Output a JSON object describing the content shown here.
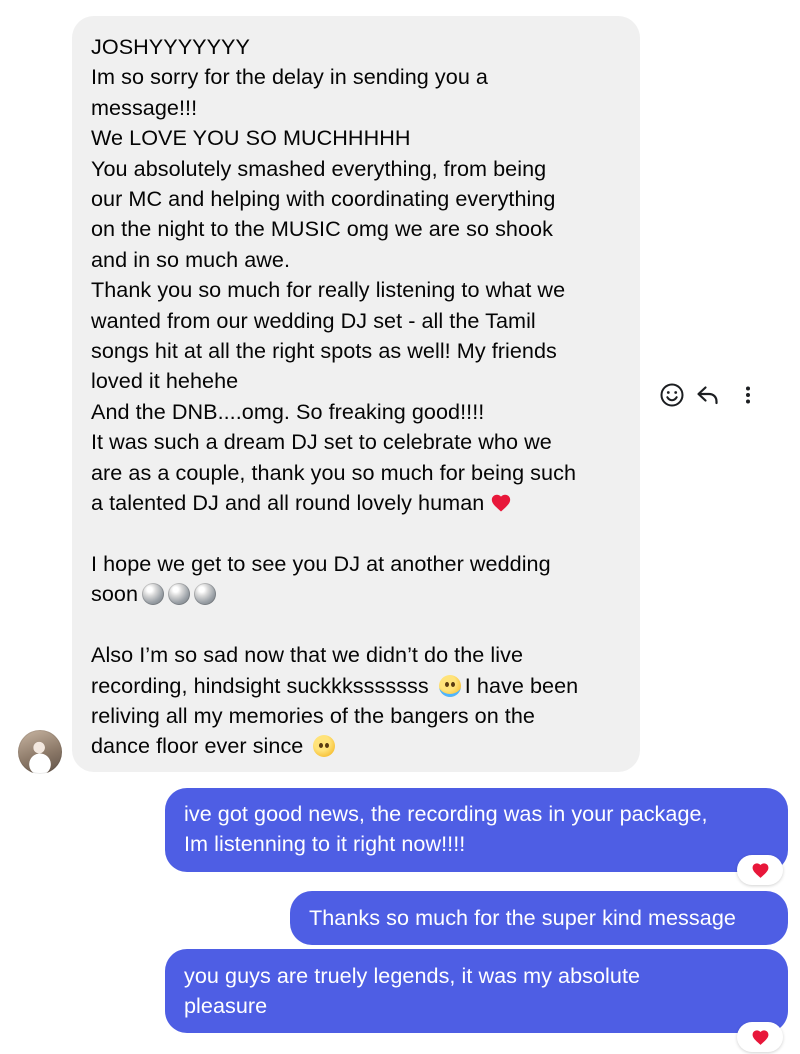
{
  "incoming_message": {
    "lines": [
      "JOSHYYYYYYY",
      "Im so sorry for the delay in sending you a",
      "message!!!",
      "We LOVE YOU SO MUCHHHHH",
      "You absolutely smashed everything, from being",
      "our MC and helping with coordinating everything",
      "on the night to the MUSIC omg we are so shook",
      "and in so much awe.",
      "Thank you so much for really listening to what we",
      "wanted from our wedding DJ set - all the Tamil",
      "songs hit at all the right spots as well! My friends",
      "loved it hehehe",
      "And the DNB....omg. So freaking good!!!!",
      "It was such a dream DJ set to celebrate who we",
      "are as a couple, thank you so much for being such",
      "a talented DJ and all round lovely human",
      "",
      "I hope we get to see you DJ at another wedding",
      "soon",
      "",
      "Also I’m so sad now that we didn’t do the live",
      "recording, hindsight suckkksssssss",
      "I have been",
      "reliving all my memories of the bangers on the",
      "dance floor ever since"
    ],
    "emojis": {
      "heart": "red-heart",
      "disco_ball": "mirror-ball",
      "crying_face": "loudly-crying-face",
      "pleading_face": "pleading-face"
    }
  },
  "actions": {
    "react_icon": "smile-icon",
    "reply_icon": "reply-icon",
    "more_icon": "more-vertical-icon"
  },
  "outgoing_messages": [
    {
      "lines": [
        "ive got good news, the recording was in your package,",
        "Im listenning to it right now!!!!"
      ],
      "reaction": "red-heart"
    },
    {
      "lines": [
        "Thanks so much for the super kind message"
      ],
      "reaction": ""
    },
    {
      "lines": [
        "you guys are truely legends, it was my absolute",
        "pleasure"
      ],
      "reaction": "red-heart"
    }
  ],
  "colors": {
    "incoming_bubble": "#f0f0f0",
    "outgoing_bubble": "#4e5ee4",
    "heart": "#e8173a"
  }
}
